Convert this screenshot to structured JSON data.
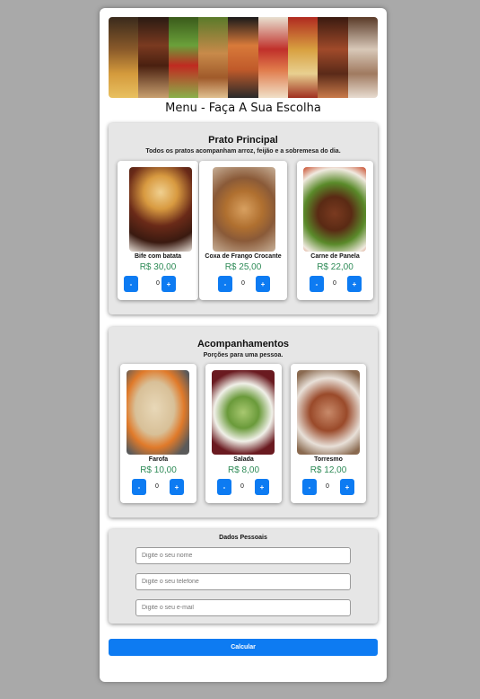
{
  "page_title": "Menu - Faça A Sua Escolha",
  "main_dishes": {
    "title": "Prato Principal",
    "subtitle": "Todos os pratos acompanham arroz, feijão e a sobremesa do dia.",
    "items": [
      {
        "name": "Bife com batata",
        "price": "R$ 30,00",
        "qty": "0"
      },
      {
        "name": "Coxa de Frango Crocante",
        "price": "R$ 25,00",
        "qty": "0"
      },
      {
        "name": "Carne de Panela",
        "price": "R$ 22,00",
        "qty": "0"
      }
    ]
  },
  "sides": {
    "title": "Acompanhamentos",
    "subtitle": "Porções para uma pessoa.",
    "items": [
      {
        "name": "Farofa",
        "price": "R$ 10,00",
        "qty": "0"
      },
      {
        "name": "Salada",
        "price": "R$ 8,00",
        "qty": "0"
      },
      {
        "name": "Torresmo",
        "price": "R$ 12,00",
        "qty": "0"
      }
    ]
  },
  "personal": {
    "title": "Dados Pessoais",
    "name_placeholder": "Digite o seu nome",
    "phone_placeholder": "Digite o seu telefone",
    "email_placeholder": "Digite o seu e-mail"
  },
  "buttons": {
    "minus": "-",
    "plus": "+",
    "calculate": "Calcular"
  },
  "colors": {
    "primary": "#0d7bf2",
    "price": "#2e8b57",
    "background": "#a9a9a9",
    "section": "#e6e6e6"
  }
}
